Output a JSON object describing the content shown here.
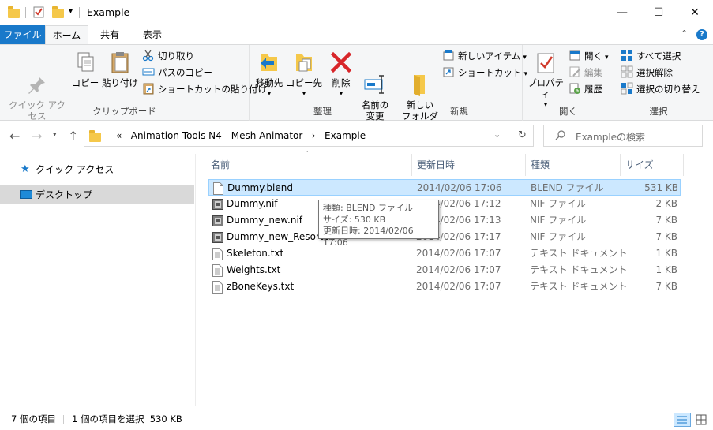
{
  "window": {
    "title": "Example",
    "minimize": "—",
    "maximize": "☐",
    "close": "✕"
  },
  "tabs": {
    "file": "ファイル",
    "home": "ホーム",
    "share": "共有",
    "view": "表示"
  },
  "ribbon": {
    "clipboard": {
      "label": "クリップボード",
      "pin": "クイック アクセス\nにピン留めする",
      "copy": "コピー",
      "paste": "貼り付け",
      "cut": "切り取り",
      "copy_path": "パスのコピー",
      "paste_shortcut": "ショートカットの貼り付け"
    },
    "organize": {
      "label": "整理",
      "move_to": "移動先",
      "copy_to": "コピー先",
      "delete": "削除",
      "rename": "名前の\n変更"
    },
    "new": {
      "label": "新規",
      "new_folder": "新しい\nフォルダー",
      "new_item": "新しいアイテム",
      "shortcut": "ショートカット"
    },
    "open": {
      "label": "開く",
      "properties": "プロパティ",
      "open": "開く",
      "edit": "編集",
      "history": "履歴"
    },
    "select": {
      "label": "選択",
      "select_all": "すべて選択",
      "select_none": "選択解除",
      "invert": "選択の切り替え"
    }
  },
  "address": {
    "prefix": "«",
    "crumbs": [
      "Animation Tools N4 - Mesh Animator",
      "Example"
    ],
    "separator": "›",
    "search_placeholder": "Exampleの検索"
  },
  "sidebar": {
    "items": [
      {
        "label": "クイック アクセス"
      },
      {
        "label": "デスクトップ"
      }
    ]
  },
  "columns": {
    "name": "名前",
    "date": "更新日時",
    "type": "種類",
    "size": "サイズ"
  },
  "files": [
    {
      "name": "Dummy.blend",
      "date": "2014/02/06 17:06",
      "type": "BLEND ファイル",
      "size": "531 KB",
      "icon": "blank-file-icon"
    },
    {
      "name": "Dummy.nif",
      "date": "2014/02/06 17:12",
      "type": "NIF ファイル",
      "size": "2 KB",
      "icon": "nif-file-icon"
    },
    {
      "name": "Dummy_new.nif",
      "date": "2014/02/06 17:13",
      "type": "NIF ファイル",
      "size": "7 KB",
      "icon": "nif-file-icon"
    },
    {
      "name": "Dummy_new_Resorted",
      "date": "2014/02/06 17:17",
      "type": "NIF ファイル",
      "size": "7 KB",
      "icon": "nif-file-icon"
    },
    {
      "name": "Skeleton.txt",
      "date": "2014/02/06 17:07",
      "type": "テキスト ドキュメント",
      "size": "1 KB",
      "icon": "text-file-icon"
    },
    {
      "name": "Weights.txt",
      "date": "2014/02/06 17:07",
      "type": "テキスト ドキュメント",
      "size": "1 KB",
      "icon": "text-file-icon"
    },
    {
      "name": "zBoneKeys.txt",
      "date": "2014/02/06 17:07",
      "type": "テキスト ドキュメント",
      "size": "7 KB",
      "icon": "text-file-icon"
    }
  ],
  "tooltip": {
    "line1": "種類: BLEND ファイル",
    "line2": "サイズ: 530 KB",
    "line3": "更新日時: 2014/02/06 17:06"
  },
  "status": {
    "count": "7 個の項目",
    "selection": "1 個の項目を選択  530 KB"
  },
  "colors": {
    "accent": "#1979ca",
    "selection": "#cce8ff",
    "folder": "#f5c84a"
  }
}
